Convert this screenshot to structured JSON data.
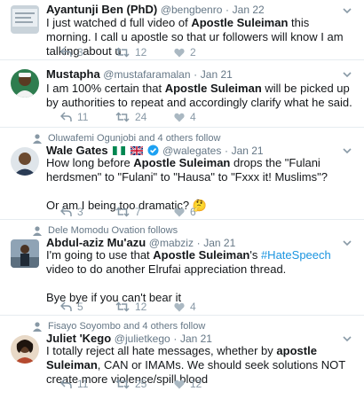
{
  "tweets": [
    {
      "context": "",
      "name": "Ayantunji Ben (PhD)",
      "handle": "@bengbenro",
      "time": "Jan 22",
      "text_parts": [
        "I just watched d full video of ",
        "Apostle Suleiman",
        " this morning. I call u apostle so that ur followers will know I am talking about u"
      ],
      "replies": "3",
      "retweets": "12",
      "likes": "2"
    },
    {
      "context": "",
      "name": "Mustapha",
      "handle": "@mustafaramalan",
      "time": "Jan 21",
      "text_parts": [
        "I am 100% certain that ",
        "Apostle Suleiman",
        " will be picked up by authorities to repeat and accordingly clarify what he said."
      ],
      "replies": "11",
      "retweets": "24",
      "likes": "4"
    },
    {
      "context": "Oluwafemi Ogunjobi and 4 others follow",
      "name": "Wale Gates",
      "handle": "@walegates",
      "time": "Jan 21",
      "text_parts": [
        "How long before ",
        "Apostle Suleiman",
        " drops the \"Fulani herdsmen\" to \"Fulani\" to \"Hausa\" to \"Fxxx it! Muslims\"?"
      ],
      "text_extra": "Or am I being too dramatic? 🤔",
      "replies": "3",
      "retweets": "7",
      "likes": "6"
    },
    {
      "context": "Dele Momodu Ovation follows",
      "name": "Abdul-aziz Mu'azu",
      "handle": "@mabziz",
      "time": "Jan 21",
      "text_parts": [
        "I'm going to use that ",
        "Apostle Suleiman",
        "'s ",
        "#HateSpeech",
        " video to do another Elrufai appreciation thread."
      ],
      "text_extra": "Bye bye if you can't bear it",
      "replies": "5",
      "retweets": "12",
      "likes": "4"
    },
    {
      "context": "Fisayo Soyombo and 4 others follow",
      "name": "Juliet 'Kego",
      "handle": "@julietkego",
      "time": "Jan 21",
      "text_parts": [
        "I totally reject all hate messages, whether by ",
        "apostle Suleiman",
        ", CAN or IMAMs. We should seek solutions NOT create more violence/spill blood"
      ],
      "replies": "11",
      "retweets": "25",
      "likes": "12"
    }
  ],
  "colors": {
    "name": "#14171a",
    "meta": "#657786",
    "action": "#8899a6",
    "hashtag": "#1b95e0",
    "verified": "#1da1f2",
    "divider": "#e6ecf0"
  },
  "icons": [
    "reply-icon",
    "retweet-icon",
    "like-icon",
    "chevron-down-icon",
    "person-follow-icon",
    "verified-badge-icon",
    "nigeria-flag-icon",
    "uk-flag-icon",
    "thinking-face-emoji"
  ]
}
